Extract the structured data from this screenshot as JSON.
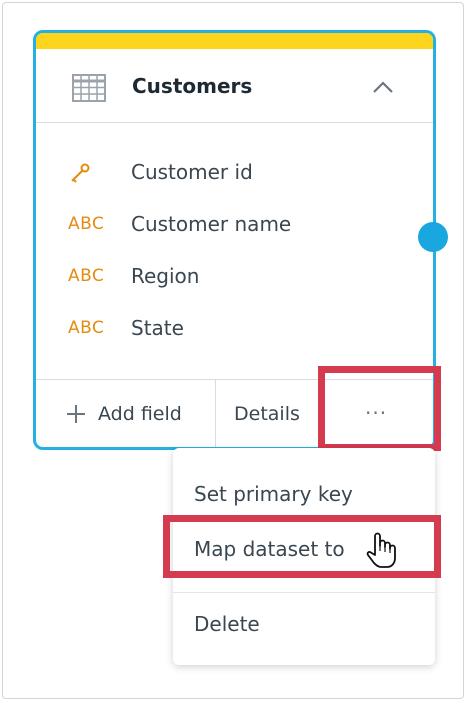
{
  "dataset_card": {
    "title": "Customers",
    "fields": [
      {
        "type_label": "",
        "type_icon": "key-icon",
        "name": "Customer id"
      },
      {
        "type_label": "ABC",
        "type_icon": "text-type-icon",
        "name": "Customer name"
      },
      {
        "type_label": "ABC",
        "type_icon": "text-type-icon",
        "name": "Region"
      },
      {
        "type_label": "ABC",
        "type_icon": "text-type-icon",
        "name": "State"
      }
    ],
    "footer": {
      "add_field_label": "Add field",
      "details_label": "Details",
      "more_label": "···"
    },
    "colors": {
      "accent_top": "#fdd51d",
      "border": "#24b0e2",
      "type": "#e58b12"
    }
  },
  "context_menu": {
    "items": [
      {
        "label": "Set primary key"
      },
      {
        "label": "Map dataset to"
      },
      {
        "label": "Delete"
      }
    ]
  },
  "highlight_color": "#d53b4f"
}
